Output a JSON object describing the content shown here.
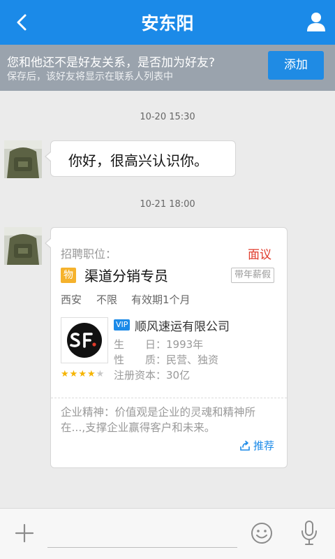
{
  "header": {
    "title": "安东阳"
  },
  "notice": {
    "line1": "您和他还不是好友关系，是否加为好友?",
    "line2": "保存后，该好友将显示在联系人列表中",
    "add_label": "添加"
  },
  "messages": [
    {
      "time": "10-20 15:30",
      "text": "你好，很高兴认识你。"
    },
    {
      "time": "10-21 18:00"
    }
  ],
  "job_card": {
    "label": "招聘职位：",
    "salary": "面议",
    "category_badge": "物",
    "title": "渠道分销专员",
    "perk": "带年薪假",
    "city": "西安",
    "experience": "不限",
    "validity": "有效期1个月",
    "vip": "VIP",
    "company": "顺风速运有限公司",
    "info_founded": "生　　日：1993年",
    "info_nature": "性　　质：民营、独资",
    "info_capital": "注册资本：30亿",
    "rating": 4,
    "rating_max": 5,
    "culture": "企业精神：价值观是企业的灵魂和精神所在...,支撑企业赢得客户和未来。",
    "recommend": "推荐"
  },
  "colors": {
    "brand": "#1b8ae8",
    "salary": "#e03a2a",
    "star": "#f5b400"
  }
}
